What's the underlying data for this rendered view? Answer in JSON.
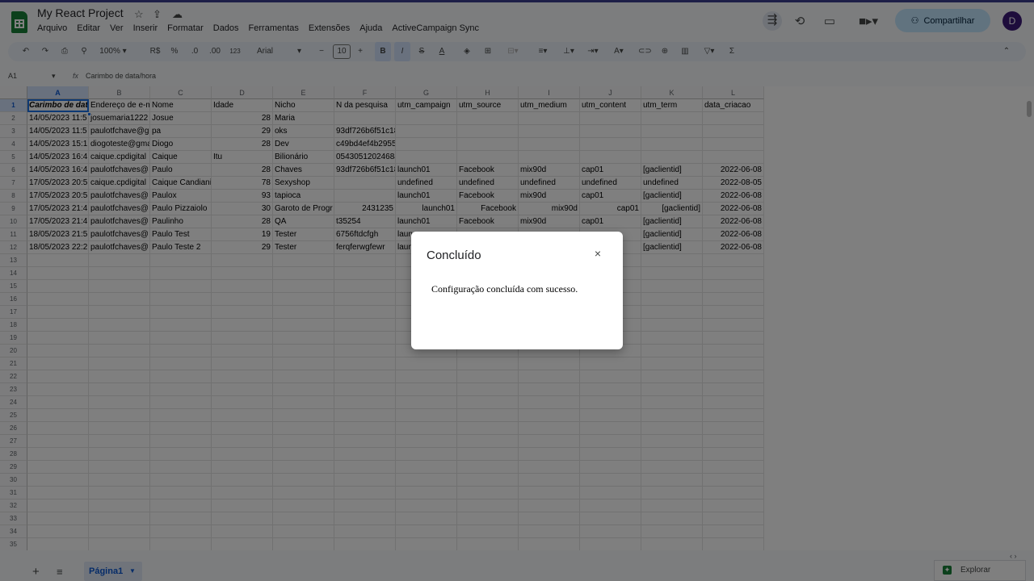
{
  "app": {
    "title": "My React Project",
    "menu": [
      "Arquivo",
      "Editar",
      "Ver",
      "Inserir",
      "Formatar",
      "Dados",
      "Ferramentas",
      "Extensões",
      "Ajuda",
      "ActiveCampaign Sync"
    ],
    "share_label": "Compartilhar",
    "avatar_letter": "D"
  },
  "toolbar": {
    "zoom": "100%",
    "currency": "R$",
    "percent": "%",
    "dec_decrease": ".0",
    "dec_increase": ".00",
    "number_format": "123",
    "font": "Arial",
    "font_size": "10",
    "bold": "B",
    "italic": "I"
  },
  "formula_bar": {
    "cell_ref": "A1",
    "fx": "fx",
    "content": "Carimbo de data/hora"
  },
  "sheet": {
    "columns": [
      "A",
      "B",
      "C",
      "D",
      "E",
      "F",
      "G",
      "H",
      "I",
      "J",
      "K",
      "L"
    ],
    "header": [
      "Carimbo de dat",
      "Endereço de e-m",
      "Nome",
      "Idade",
      "Nicho",
      "N da pesquisa",
      "utm_campaign",
      "utm_source",
      "utm_medium",
      "utm_content",
      "utm_term",
      "data_criacao"
    ],
    "rows": [
      [
        "14/05/2023 11:5",
        "josuemaria1222",
        "Josue",
        "28",
        "Maria",
        "",
        "",
        "",
        "",
        "",
        "",
        ""
      ],
      [
        "14/05/2023 11:5",
        "paulotfchave@g",
        "pa",
        "29",
        "oks",
        "93df726b6f51c18f",
        "",
        "",
        "",
        "",
        "",
        ""
      ],
      [
        "14/05/2023 15:1",
        "diogoteste@gma",
        "Diogo",
        "28",
        "Dev",
        "c49bd4ef4b295585",
        "",
        "",
        "",
        "",
        "",
        ""
      ],
      [
        "14/05/2023 16:4",
        "caique.cpdigital",
        "Caique",
        "Itu",
        "Bilionário",
        "0543051202468ac8",
        "",
        "",
        "",
        "",
        "",
        ""
      ],
      [
        "14/05/2023 16:4",
        "paulotfchaves@",
        "Paulo",
        "28",
        "Chaves",
        "93df726b6f51c18",
        "launch01",
        "Facebook",
        "mix90d",
        "cap01",
        "[gaclientid]",
        "2022-06-08"
      ],
      [
        "17/05/2023 20:5",
        "caique.cpdigital",
        "Caique Candiani",
        "78",
        "Sexyshop",
        "",
        "undefined",
        "undefined",
        "undefined",
        "undefined",
        "undefined",
        "2022-08-05"
      ],
      [
        "17/05/2023 20:5",
        "paulotfchaves@",
        "Paulox",
        "93",
        "tapioca",
        "",
        "launch01",
        "Facebook",
        "mix90d",
        "cap01",
        "[gaclientid]",
        "2022-06-08"
      ],
      [
        "17/05/2023 21:4",
        "paulotfchaves@",
        "Paulo Pizzaiolo",
        "30",
        "Garoto de Progr",
        "2431235",
        "launch01",
        "Facebook",
        "mix90d",
        "cap01",
        "[gaclientid]",
        "2022-06-08"
      ],
      [
        "17/05/2023 21:4",
        "paulotfchaves@",
        "Paulinho",
        "28",
        "QA",
        "t35254",
        "launch01",
        "Facebook",
        "mix90d",
        "cap01",
        "[gaclientid]",
        "2022-06-08"
      ],
      [
        "18/05/2023 21:5",
        "paulotfchaves@",
        "Paulo Test",
        "19",
        "Tester",
        "6756ftdcfgh",
        "laun",
        "",
        "",
        "",
        "[gaclientid]",
        "2022-06-08"
      ],
      [
        "18/05/2023 22:2",
        "paulotfchaves@",
        "Paulo Teste 2",
        "29",
        "Tester",
        "ferqferwgfewr",
        "laun",
        "",
        "",
        "",
        "[gaclientid]",
        "2022-06-08"
      ]
    ],
    "total_rows_visible": 35
  },
  "bottom": {
    "add_sheet": "+",
    "all_sheets": "≡",
    "active_tab": "Página1",
    "explore_label": "Explorar"
  },
  "dialog": {
    "title": "Concluído",
    "close": "×",
    "message": "Configuração concluída com sucesso."
  }
}
